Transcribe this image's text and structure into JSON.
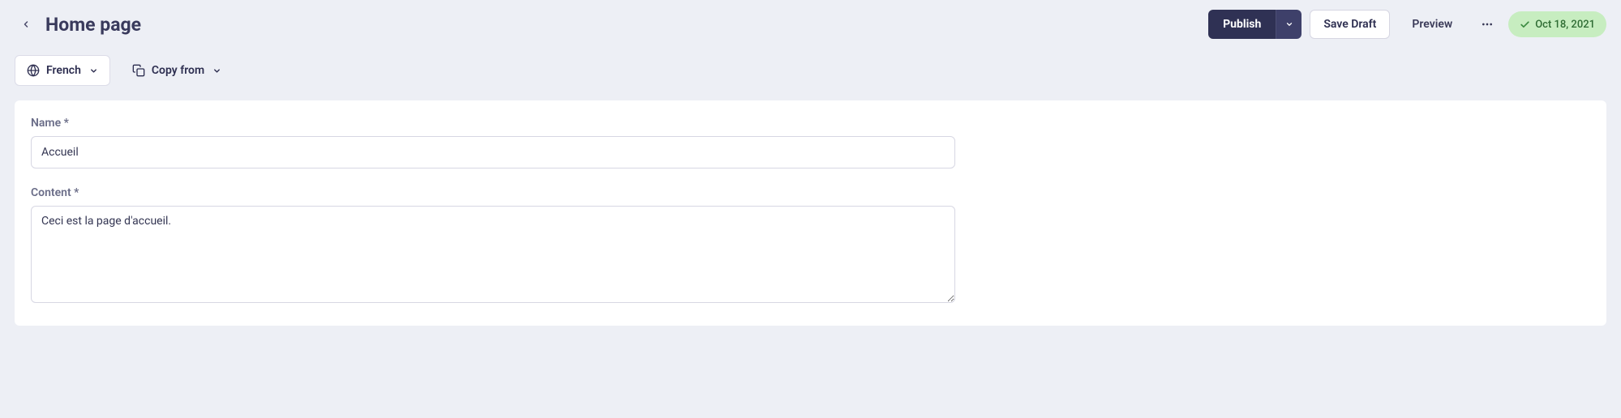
{
  "header": {
    "title": "Home page",
    "publish_label": "Publish",
    "save_draft_label": "Save Draft",
    "preview_label": "Preview",
    "status_date": "Oct 18, 2021"
  },
  "toolbar": {
    "language_label": "French",
    "copy_from_label": "Copy from"
  },
  "form": {
    "name_label": "Name *",
    "name_value": "Accueil",
    "content_label": "Content *",
    "content_value": "Ceci est la page d'accueil."
  }
}
